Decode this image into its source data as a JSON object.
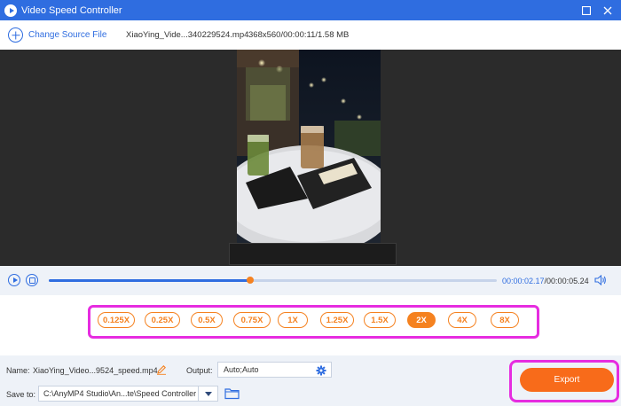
{
  "window": {
    "title": "Video Speed Controller"
  },
  "source": {
    "change_label": "Change Source File",
    "file_name": "XiaoYing_Vide...340229524.mp4",
    "file_info": "368x560/00:00:11/1.58 MB"
  },
  "player": {
    "current_time": "00:00:02.17",
    "total_time": "/00:00:05.24",
    "progress_fraction": 0.45
  },
  "speeds": {
    "options": [
      "0.125X",
      "0.25X",
      "0.5X",
      "0.75X",
      "1X",
      "1.25X",
      "1.5X",
      "2X",
      "4X",
      "8X"
    ],
    "selected": "2X"
  },
  "output": {
    "name_label": "Name:",
    "name_value": "XiaoYing_Video...9524_speed.mp4",
    "output_label": "Output:",
    "output_value": "Auto;Auto",
    "save_label": "Save to:",
    "save_path": "C:\\AnyMP4 Studio\\An...te\\Speed Controller",
    "export_label": "Export"
  },
  "colors": {
    "brand": "#2f6de0",
    "accent": "#f58220",
    "highlight": "#e62ce0"
  }
}
